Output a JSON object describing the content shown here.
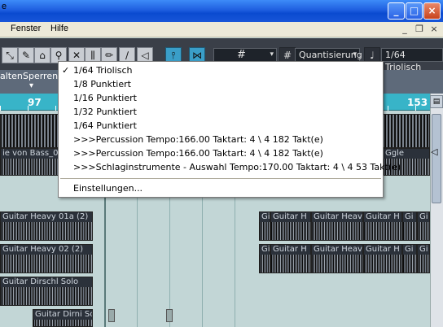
{
  "window": {
    "minimize": "_",
    "maximize": "□",
    "close": "×"
  },
  "menubar": {
    "items": [
      "Fenster",
      "Hilfe"
    ],
    "partial": "e",
    "mdi_min": "_",
    "mdi_restore": "❐",
    "mdi_close": "×"
  },
  "toolbar": {
    "tools": [
      "select-tool",
      "range-tool",
      "glue-tool",
      "zoom-tool",
      "erase-tool",
      "split-tool",
      "draw-tool",
      "line-tool",
      "speaker-tool"
    ],
    "snap_icon": "#",
    "quantize_label": "Quantisierung",
    "quantize_value": "1/64 Triolisch"
  },
  "columns": {
    "col1": "alten",
    "col2": "Sperren"
  },
  "ruler": {
    "m97": "97",
    "m153": "153"
  },
  "tracks": [
    {
      "clips": [
        {
          "label": ""
        }
      ]
    },
    {
      "clips": [
        {
          "label": "ie von Bass_0"
        },
        {
          "label": "Ggle"
        }
      ]
    },
    {
      "clips": []
    },
    {
      "clips": [
        {
          "label": "Guitar Heavy 01a (2)"
        },
        {
          "label": "Gi"
        },
        {
          "label": "Guitar H"
        },
        {
          "label": "Guitar Heav"
        },
        {
          "label": "Guitar H"
        },
        {
          "label": "Gi"
        },
        {
          "label": "Gi"
        }
      ]
    },
    {
      "clips": [
        {
          "label": "Guitar Heavy 02 (2)"
        },
        {
          "label": "Gi"
        },
        {
          "label": "Guitar H"
        },
        {
          "label": "Guitar Heav"
        },
        {
          "label": "Guitar H"
        },
        {
          "label": "Gi"
        },
        {
          "label": "Gi"
        }
      ]
    },
    {
      "clips": [
        {
          "label": "Guitar Dirschl Solo"
        }
      ]
    },
    {
      "clips": [
        {
          "label": "Guitar Dirni Sol"
        }
      ]
    }
  ],
  "dropdown": {
    "checked_index": 0,
    "items": [
      "1/64 Triolisch",
      "1/8 Punktiert",
      "1/16 Punktiert",
      "1/32 Punktiert",
      "1/64 Punktiert",
      ">>>Percussion Tempo:166.00 Taktart: 4 \\ 4  182 Takt(e)",
      ">>>Percussion Tempo:166.00 Taktart: 4 \\ 4  182 Takt(e)",
      ">>>Schlaginstrumente - Auswahl Tempo:170.00 Taktart: 4 \\ 4  53 Takt(e)"
    ],
    "settings": "Einstellungen..."
  },
  "colors": {
    "accent": "#38b4c8",
    "arrange_bg": "#c2d6d6",
    "toolbar_bg": "#3a3f48"
  }
}
